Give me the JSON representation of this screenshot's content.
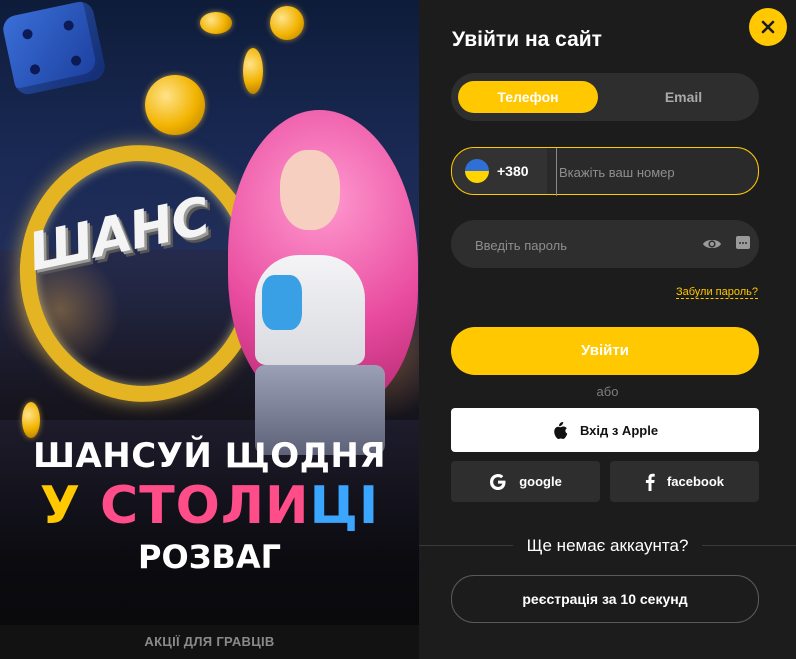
{
  "promo": {
    "logo_text": "ШАНС",
    "headline_1": "ШАНСУЙ ЩОДНЯ",
    "headline_2_part_1": "У ",
    "headline_2_part_2": "СТОЛИ",
    "headline_2_part_3": "ЦІ",
    "headline_3": "РОЗВАГ",
    "footer_link": "АКЦІЇ ДЛЯ ГРАВЦІВ"
  },
  "login": {
    "title": "Увійти на сайт",
    "close_icon": "close-icon",
    "tabs": [
      {
        "label": "Телефон",
        "active": true
      },
      {
        "label": "Email",
        "active": false
      }
    ],
    "phone": {
      "country_code": "+380",
      "flag": "ukraine-flag-icon",
      "placeholder": "Вкажіть ваш номер",
      "value": ""
    },
    "password": {
      "placeholder": "Введіть пароль",
      "value": ""
    },
    "forgot_password": "Забули пароль?",
    "submit_label": "Увійти",
    "or_label": "або",
    "apple_label": "Вхід з Apple",
    "google_label": "google",
    "facebook_label": "facebook",
    "no_account_label": "Ще немає аккаунта?",
    "register_label": "реєстрація за 10 секунд"
  },
  "colors": {
    "accent": "#ffc800",
    "panel_bg": "#1c1c1c",
    "field_bg": "#2e2e2e"
  }
}
